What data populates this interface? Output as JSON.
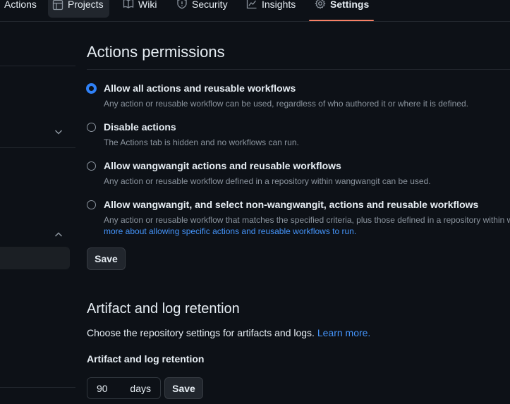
{
  "nav": {
    "tabs": [
      {
        "label": "Actions"
      },
      {
        "label": "Projects",
        "icon": "table-icon"
      },
      {
        "label": "Wiki",
        "icon": "book-icon"
      },
      {
        "label": "Security",
        "icon": "shield-icon"
      },
      {
        "label": "Insights",
        "icon": "graph-icon"
      },
      {
        "label": "Settings",
        "icon": "gear-icon",
        "selected": true
      }
    ],
    "accent": "#f78166"
  },
  "permissions": {
    "heading": "Actions permissions",
    "options": [
      {
        "title": "Allow all actions and reusable workflows",
        "desc": "Any action or reusable workflow can be used, regardless of who authored it or where it is defined.",
        "checked": true
      },
      {
        "title": "Disable actions",
        "desc": "The Actions tab is hidden and no workflows can run.",
        "checked": false
      },
      {
        "title": "Allow wangwangit actions and reusable workflows",
        "desc": "Any action or reusable workflow defined in a repository within wangwangit can be used.",
        "checked": false
      },
      {
        "title": "Allow wangwangit, and select non-wangwangit, actions and reusable workflows",
        "desc": "Any action or reusable workflow that matches the specified criteria, plus those defined in a repository within w",
        "link": "more about allowing specific actions and reusable workflows to run.",
        "checked": false
      }
    ],
    "save_label": "Save"
  },
  "retention": {
    "heading": "Artifact and log retention",
    "desc": "Choose the repository settings for artifacts and logs.",
    "learn_more": "Learn more.",
    "field_label": "Artifact and log retention",
    "value": "90",
    "unit": "days",
    "save_label": "Save"
  },
  "colors": {
    "bg": "#0d1117",
    "link": "#4493f8",
    "radio_checked": "#2f81f7"
  }
}
